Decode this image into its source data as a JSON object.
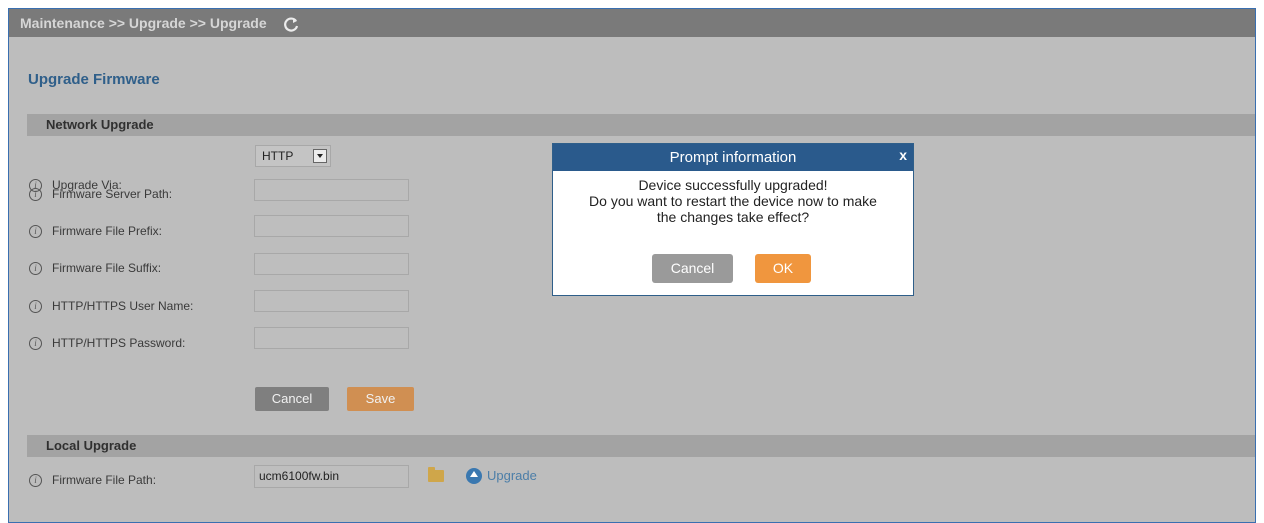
{
  "breadcrumb": "Maintenance >> Upgrade >> Upgrade",
  "page_title": "Upgrade Firmware",
  "network_upgrade": {
    "title": "Network Upgrade",
    "upgrade_via_label": "Upgrade Via:",
    "upgrade_via_value": "HTTP",
    "server_path_label": "Firmware Server Path:",
    "file_prefix_label": "Firmware File Prefix:",
    "file_suffix_label": "Firmware File Suffix:",
    "user_name_label": "HTTP/HTTPS User Name:",
    "password_label": "HTTP/HTTPS Password:",
    "cancel_label": "Cancel",
    "save_label": "Save"
  },
  "local_upgrade": {
    "title": "Local Upgrade",
    "file_path_label": "Firmware File Path:",
    "file_path_value": "ucm6100fw.bin",
    "upgrade_label": "Upgrade"
  },
  "modal": {
    "title": "Prompt information",
    "close": "x",
    "line1": "Device successfully upgraded!",
    "line2": "Do you want to restart the device now to make",
    "line3": "the changes take effect?",
    "cancel_label": "Cancel",
    "ok_label": "OK"
  },
  "colors": {
    "header_blue": "#2a5a8c",
    "ok_orange": "#f0963e",
    "cancel_gray": "#9a9a9a"
  }
}
